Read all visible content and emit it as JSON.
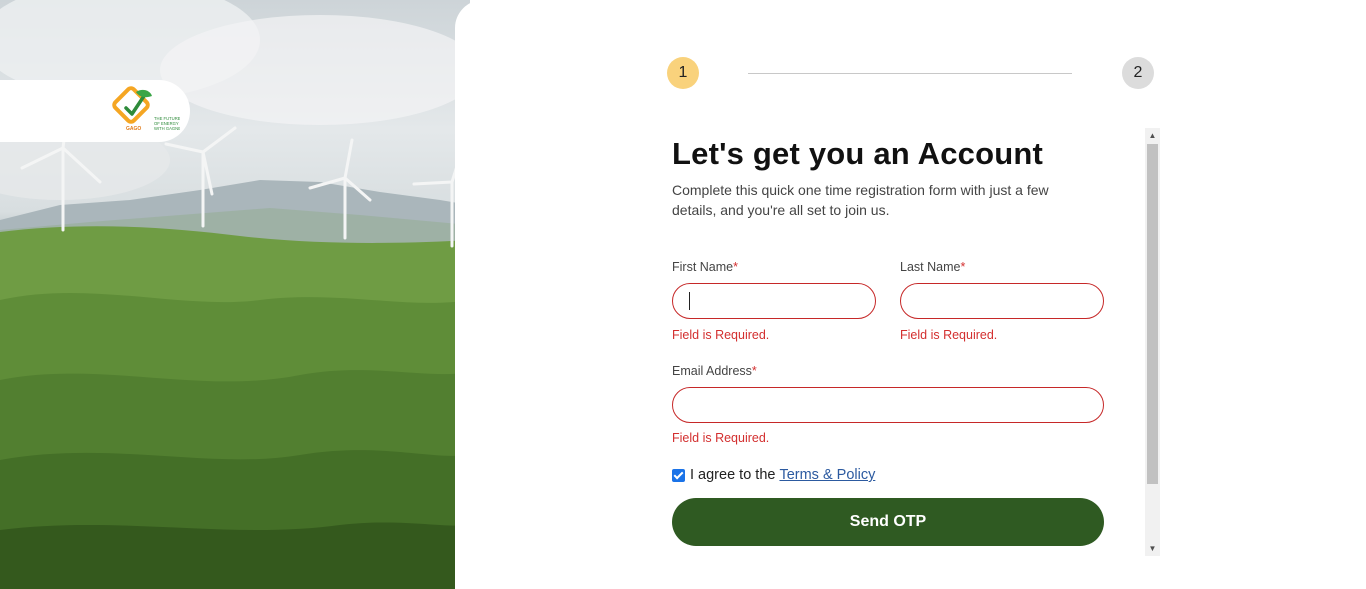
{
  "brand": {
    "logo_name": "GAGO",
    "tagline": "THE FUTURE OF ENERGY WITH GAGNE"
  },
  "stepper": {
    "step1": "1",
    "step2": "2"
  },
  "form": {
    "title": "Let's get you an Account",
    "subtitle": "Complete this quick one time registration form with just a few details, and you're all set to join us.",
    "first_name_label": "First Name",
    "last_name_label": "Last Name",
    "email_label": "Email Address",
    "required_mark": "*",
    "error_text": "Field is Required.",
    "agree_text": "I agree to the",
    "terms_link": "Terms & Policy",
    "submit_label": "Send OTP"
  },
  "icons": {
    "checkbox": "checkbox-checked-icon",
    "scroll_up": "triangle-up-icon",
    "scroll_down": "triangle-down-icon"
  },
  "colors": {
    "primary_button": "#2f5a22",
    "active_step": "#f9d27c",
    "inactive_step": "#dcdcdc",
    "error": "#d32f2f",
    "link": "#2c5aa0"
  }
}
